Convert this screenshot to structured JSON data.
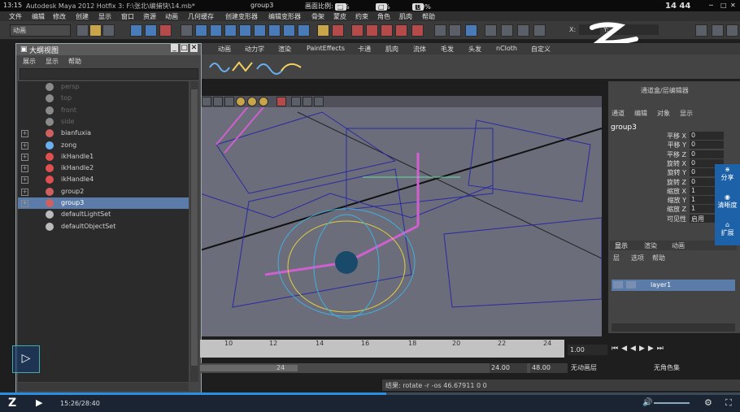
{
  "window": {
    "title": "Autodesk Maya 2012 Hotfix 3: F:\\张北\\编捕快\\14.mb*",
    "clock_left": "13:15",
    "selected_object": "group3",
    "aspect_label": "画面比例:",
    "aspect_options": [
      "50%",
      "75%",
      "100%"
    ],
    "clock_right": "14 44"
  },
  "menubar": [
    "文件",
    "编辑",
    "修改",
    "创建",
    "显示",
    "窗口",
    "资源",
    "动画",
    "几何缓存",
    "创建变形器",
    "编辑变形器",
    "骨架",
    "蒙皮",
    "约束",
    "角色",
    "肌肉",
    "帮助"
  ],
  "statusline": {
    "mode": "动画",
    "x_label": "X:",
    "y_label": "Y:"
  },
  "shelf_tabs": [
    "动画",
    "动力学",
    "渲染",
    "PaintEffects",
    "卡通",
    "肌肉",
    "流体",
    "毛发",
    "头发",
    "nCloth",
    "自定义"
  ],
  "outliner": {
    "title": "大纲视图",
    "menu": [
      "展示",
      "显示",
      "帮助"
    ],
    "items": [
      {
        "label": "persp",
        "type": "camera",
        "dim": true,
        "expand": false
      },
      {
        "label": "top",
        "type": "camera",
        "dim": true,
        "expand": false
      },
      {
        "label": "front",
        "type": "camera",
        "dim": true,
        "expand": false
      },
      {
        "label": "side",
        "type": "camera",
        "dim": true,
        "expand": false
      },
      {
        "label": "bianfuxia",
        "type": "mesh",
        "dim": false,
        "expand": true
      },
      {
        "label": "zong",
        "type": "curve",
        "dim": false,
        "expand": true
      },
      {
        "label": "ikHandle1",
        "type": "ik",
        "dim": false,
        "expand": true
      },
      {
        "label": "ikHandle2",
        "type": "ik",
        "dim": false,
        "expand": true
      },
      {
        "label": "ikHandle4",
        "type": "ik",
        "dim": false,
        "expand": true
      },
      {
        "label": "group2",
        "type": "group",
        "dim": false,
        "expand": true
      },
      {
        "label": "group3",
        "type": "group",
        "dim": false,
        "expand": true,
        "selected": true
      },
      {
        "label": "defaultLightSet",
        "type": "set",
        "dim": false,
        "expand": false
      },
      {
        "label": "defaultObjectSet",
        "type": "set",
        "dim": false,
        "expand": false
      }
    ]
  },
  "channel_box": {
    "header": "通道盒/层编辑器",
    "menu": [
      "通道",
      "编辑",
      "对象",
      "显示"
    ],
    "object": "group3",
    "attrs": [
      {
        "k": "平移 X",
        "v": "0"
      },
      {
        "k": "平移 Y",
        "v": "0"
      },
      {
        "k": "平移 Z",
        "v": "0"
      },
      {
        "k": "旋转 X",
        "v": "0"
      },
      {
        "k": "旋转 Y",
        "v": "0"
      },
      {
        "k": "旋转 Z",
        "v": "0"
      },
      {
        "k": "缩放 X",
        "v": "1"
      },
      {
        "k": "缩放 Y",
        "v": "1"
      },
      {
        "k": "缩放 Z",
        "v": "1"
      },
      {
        "k": "可见性",
        "v": "启用"
      }
    ],
    "layer_tabs": [
      "显示",
      "渲染",
      "动画"
    ],
    "layer_menu": [
      "层",
      "选项",
      "帮助"
    ],
    "layer_name": "layer1"
  },
  "side_panel": [
    "分享",
    "清晰度",
    "扩展"
  ],
  "timeline": {
    "ticks": [
      "10",
      "12",
      "14",
      "16",
      "18",
      "20",
      "22",
      "24"
    ],
    "current_frame": "1.00",
    "range_current": "24",
    "range_start": "24.00",
    "range_end": "48.00",
    "anim_layer": "无动画层",
    "char_set": "无角色集"
  },
  "cmdline": {
    "result": "结果: rotate -r -os 46.67911 0 0"
  },
  "player": {
    "time": "15:26/28:40"
  }
}
